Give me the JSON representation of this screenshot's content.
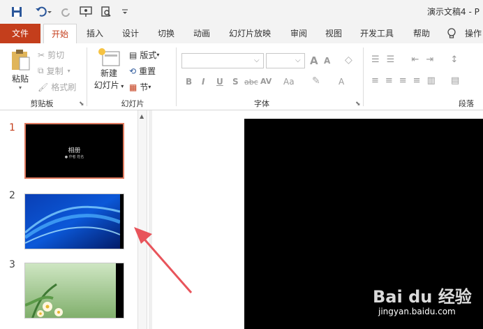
{
  "titlebar": {
    "doc_title": "演示文稿4 - P"
  },
  "tabs": [
    {
      "label": "文件"
    },
    {
      "label": "开始"
    },
    {
      "label": "插入"
    },
    {
      "label": "设计"
    },
    {
      "label": "切换"
    },
    {
      "label": "动画"
    },
    {
      "label": "幻灯片放映"
    },
    {
      "label": "审阅"
    },
    {
      "label": "视图"
    },
    {
      "label": "开发工具"
    },
    {
      "label": "帮助"
    },
    {
      "label": "操作"
    }
  ],
  "ribbon": {
    "clipboard": {
      "paste": "粘贴",
      "cut": "剪切",
      "copy": "复制",
      "format_painter": "格式刷",
      "group_label": "剪贴板"
    },
    "slides": {
      "new_slide_line1": "新建",
      "new_slide_line2": "幻灯片",
      "layout": "版式",
      "reset": "重置",
      "section": "节",
      "group_label": "幻灯片"
    },
    "font": {
      "group_label": "字体",
      "increase": "A",
      "decrease": "A",
      "bold": "B",
      "italic": "I",
      "underline": "U",
      "shadow": "S",
      "strike": "abc",
      "spacing": "AV",
      "case": "Aa",
      "color": "A"
    },
    "paragraph": {
      "group_label": "段落"
    }
  },
  "slides": [
    {
      "number": "1",
      "title": "相册",
      "subtitle": "● 作者 姓名"
    },
    {
      "number": "2"
    },
    {
      "number": "3"
    }
  ],
  "watermark": {
    "brand": "Bai du 经验",
    "url": "jingyan.baidu.com"
  },
  "colors": {
    "accent": "#c43e1c",
    "selection_border": "#e07a5f",
    "arrow": "#e8545b"
  }
}
